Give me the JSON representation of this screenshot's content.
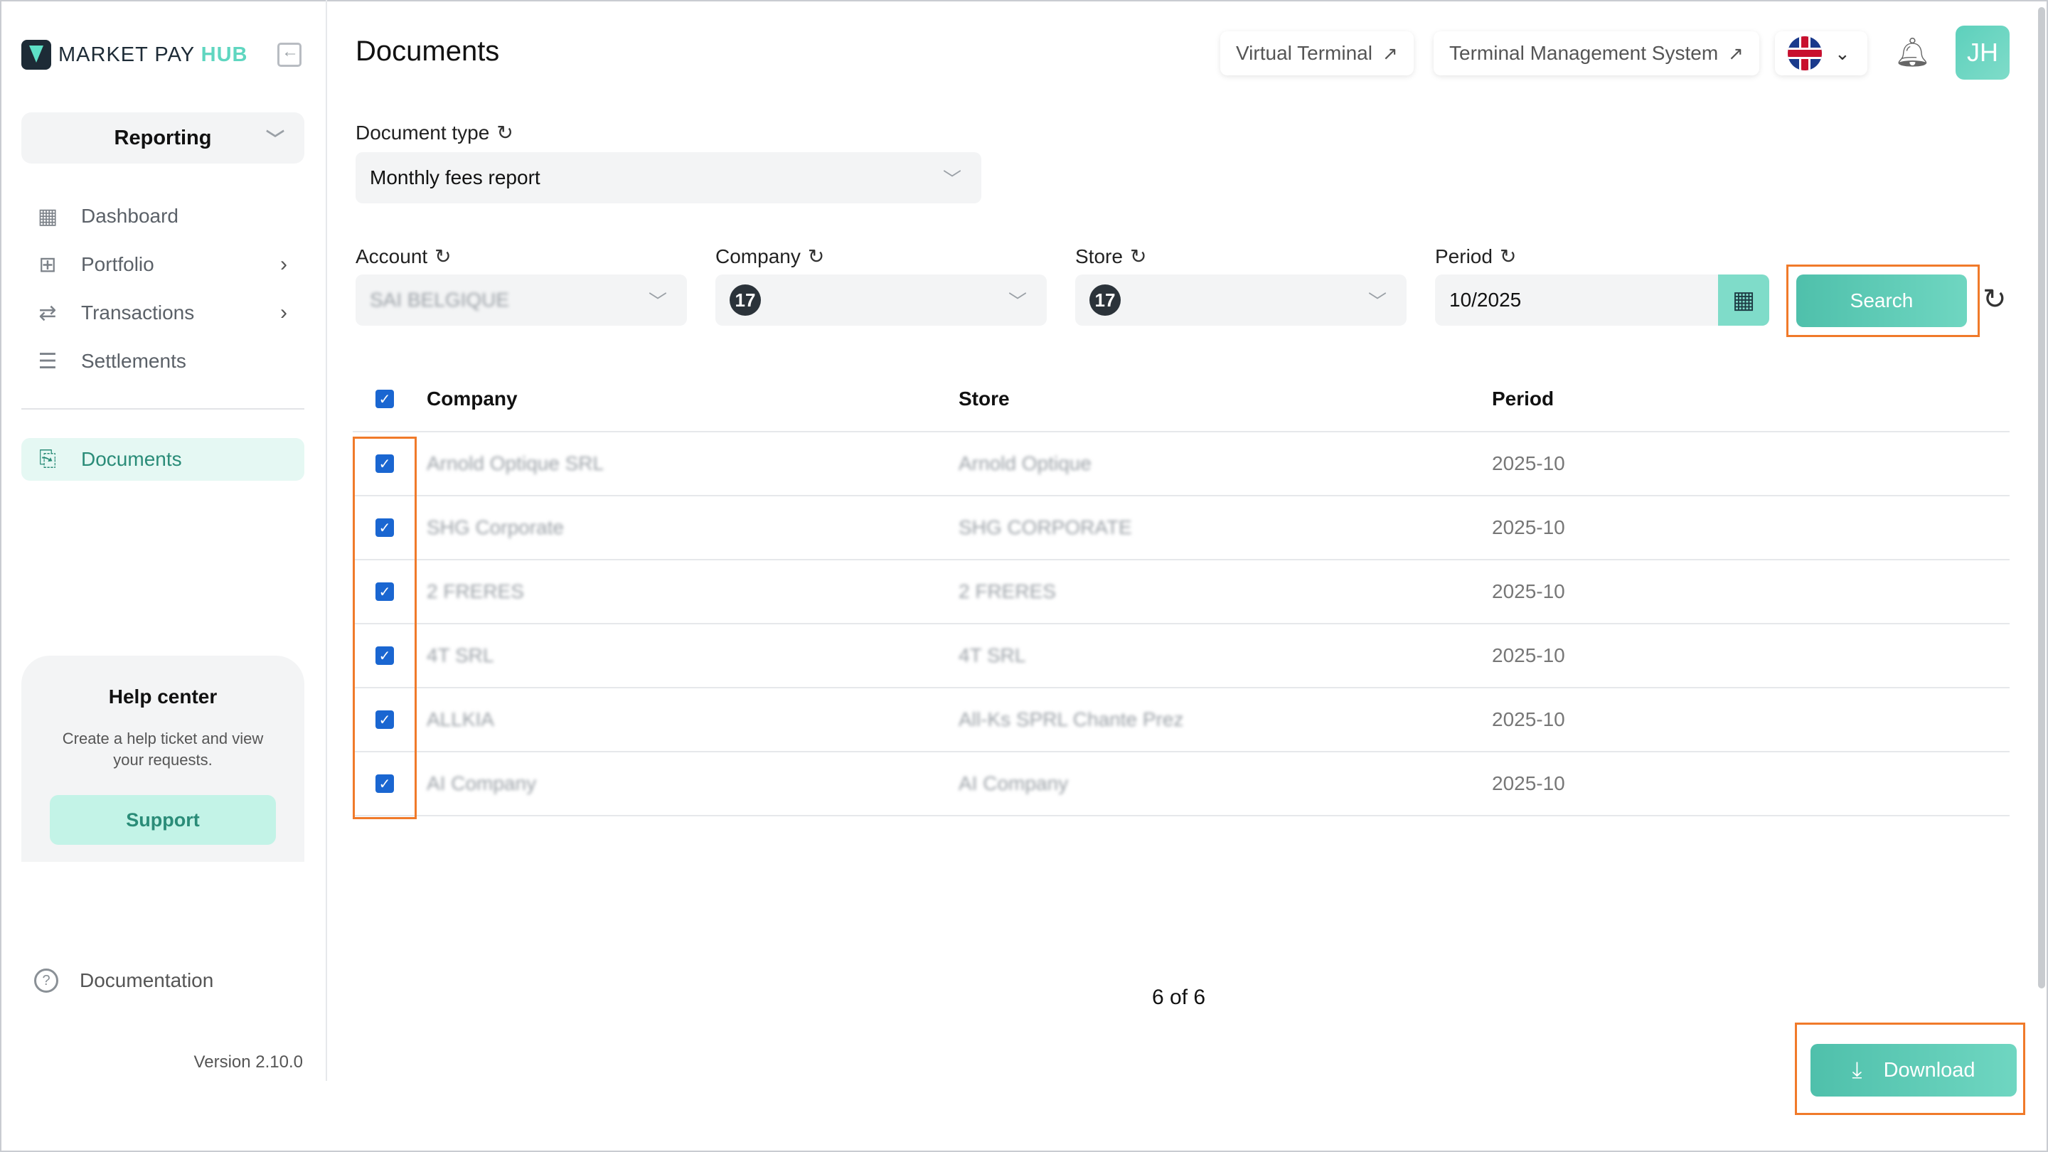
{
  "app": {
    "logo_text": "MARKET PAY",
    "logo_hub": "HUB",
    "version": "Version 2.10.0"
  },
  "sidebar": {
    "section": "Reporting",
    "items": [
      {
        "label": "Dashboard",
        "icon": "dashboard-icon"
      },
      {
        "label": "Portfolio",
        "icon": "portfolio-icon"
      },
      {
        "label": "Transactions",
        "icon": "transactions-icon"
      },
      {
        "label": "Settlements",
        "icon": "settlements-icon"
      }
    ],
    "active_item": "Documents",
    "help": {
      "title": "Help center",
      "text": "Create a help ticket and view your requests.",
      "button": "Support"
    },
    "documentation": "Documentation"
  },
  "header": {
    "title": "Documents",
    "virtual_terminal": "Virtual Terminal",
    "tms": "Terminal Management System",
    "avatar_initials": "JH"
  },
  "filters": {
    "document_type_label": "Document type",
    "document_type_value": "Monthly fees report",
    "account_label": "Account",
    "account_value": "SAI BELGIQUE",
    "company_label": "Company",
    "company_count": "17",
    "store_label": "Store",
    "store_count": "17",
    "period_label": "Period",
    "period_value": "10/2025",
    "search_label": "Search"
  },
  "table": {
    "headers": {
      "company": "Company",
      "store": "Store",
      "period": "Period"
    },
    "rows": [
      {
        "company": "Arnold Optique SRL",
        "store": "Arnold Optique",
        "period": "2025-10"
      },
      {
        "company": "SHG Corporate",
        "store": "SHG CORPORATE",
        "period": "2025-10"
      },
      {
        "company": "2 FRERES",
        "store": "2 FRERES",
        "period": "2025-10"
      },
      {
        "company": "4T SRL",
        "store": "4T SRL",
        "period": "2025-10"
      },
      {
        "company": "ALLKIA",
        "store": "All-Ks SPRL Chante Prez",
        "period": "2025-10"
      },
      {
        "company": "AI Company",
        "store": "AI Company",
        "period": "2025-10"
      }
    ],
    "pager": "6 of 6"
  },
  "actions": {
    "download": "Download"
  },
  "colors": {
    "accent": "#5fd6c0",
    "highlight": "#f07a2a",
    "checkbox": "#1a66d1"
  }
}
